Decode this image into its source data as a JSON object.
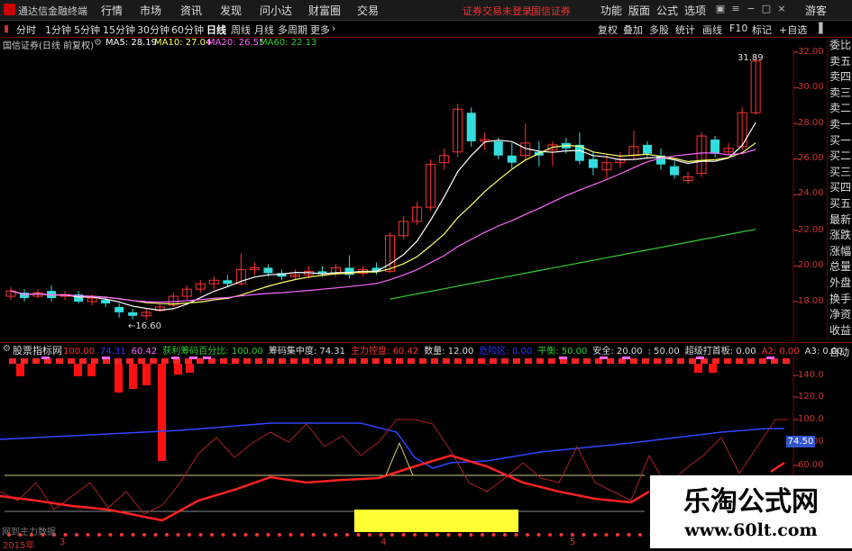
{
  "window": {
    "title": "通达信金融终端",
    "menus": [
      "行情",
      "市场",
      "资讯",
      "发现",
      "问小达",
      "财富圈",
      "交易"
    ],
    "login_text": "证券交易未登录",
    "broker": "国信证券",
    "tools": [
      "功能",
      "版面",
      "公式",
      "选项"
    ],
    "guest": "游客"
  },
  "periods": [
    "分时",
    "1分钟",
    "5分钟",
    "15分钟",
    "30分钟",
    "60分钟",
    "日线",
    "周线",
    "月线",
    "多周期",
    "更多"
  ],
  "active_period": "日线",
  "toolbar_right": [
    "复权",
    "叠加",
    "多股",
    "统计",
    "画线",
    "F10",
    "标记",
    "+自选"
  ],
  "ma_line": {
    "stock": "国信证券(日线 前复权)",
    "ma5": "MA5: 28.19",
    "ma10": "MA10: 27.04",
    "ma20": "MA20: 26.55",
    "ma60": "MA60: 22.13",
    "colors": {
      "ma5": "#ffffff",
      "ma10": "#ffff66",
      "ma20": "#ff66ff",
      "ma60": "#33cc33"
    }
  },
  "right_panel": [
    "委比",
    "卖五",
    "卖四",
    "卖三",
    "卖二",
    "卖一",
    "买一",
    "买二",
    "买三",
    "买四",
    "买五",
    "最新",
    "涨跌",
    "涨幅",
    "总量",
    "外盘",
    "换手",
    "净资",
    "收益"
  ],
  "price_axis": [
    "32.00",
    "30.00",
    "28.00",
    "26.00",
    "24.00",
    "22.00",
    "20.00",
    "18.00"
  ],
  "price_labels": {
    "high": "31.89",
    "low": "16.60"
  },
  "indicator": {
    "name": "股票指标网",
    "items": [
      {
        "text": "100.00",
        "color": "#ff3333"
      },
      {
        "text": "74.31",
        "color": "#3333ff"
      },
      {
        "text": "60.42",
        "color": "#ff66ff"
      },
      {
        "text": "获利筹码百分比: 100.00",
        "color": "#33cc33"
      },
      {
        "text": "筹码集中度: 74.31",
        "color": "#dddddd"
      },
      {
        "text": "主力控盘: 60.42",
        "color": "#ff3333"
      },
      {
        "text": "数量: 12.00",
        "color": "#dddddd"
      },
      {
        "text": "危险区: 0.00",
        "color": "#3333ff"
      },
      {
        "text": "平衡: 50.00",
        "color": "#33cc33"
      },
      {
        "text": "安全: 20.00",
        "color": "#dddddd"
      },
      {
        "text": ": 50.00",
        "color": "#dddddd"
      },
      {
        "text": "超级打首板: 0.00",
        "color": "#dddddd"
      },
      {
        "text": "A2: 0.00",
        "color": "#ff3333"
      },
      {
        "text": "A3: 0.00",
        "color": "#dddddd"
      }
    ],
    "auto_btn": "自动"
  },
  "indicator_axis": [
    "140.0",
    "120.0",
    "100.0",
    "80.00",
    "60.00"
  ],
  "current_value": "74.50",
  "time_axis": [
    "2015年",
    "3",
    "4",
    "5"
  ],
  "bottom_note": "网到主力数据",
  "watermark": {
    "title": "乐淘公式网",
    "url": "www.60lt.com"
  }
}
